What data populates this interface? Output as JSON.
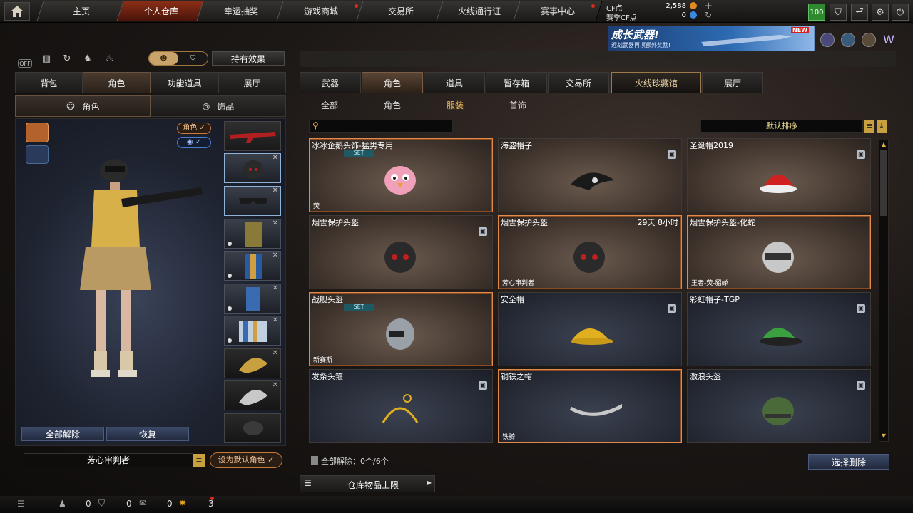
{
  "topnav": {
    "tabs": [
      "主页",
      "个人仓库",
      "幸运抽奖",
      "游戏商城",
      "交易所",
      "火线通行证",
      "赛事中心"
    ],
    "active_index": 1,
    "cf_points_label": "CF点",
    "cf_points_value": "2,588",
    "match_cf_label": "赛季CF点",
    "match_cf_value": "0",
    "level_badge": "100"
  },
  "promo": {
    "title": "成长武器!",
    "subtitle": "近战武器再项额外奖励!",
    "badge": "NEW"
  },
  "left": {
    "off_label": "OFF",
    "hold_effect_label": "持有效果",
    "tabs": [
      "背包",
      "角色",
      "功能道具",
      "展厅"
    ],
    "active_tab": 1,
    "subtabs": [
      "角色",
      "饰品"
    ],
    "badge_role": "角色 ✓",
    "badge_eye": "◉ ✓",
    "unequip_all": "全部解除",
    "restore": "恢复",
    "char_name": "芳心审判者",
    "set_default": "设为默认角色"
  },
  "right": {
    "tabs": [
      "武器",
      "角色",
      "道具",
      "暂存箱",
      "交易所",
      "火线珍藏馆",
      "展厅"
    ],
    "active_tab": 1,
    "subtabs": [
      "全部",
      "角色",
      "服装",
      "首饰"
    ],
    "active_subtab": 2,
    "search_placeholder": "",
    "sort_label": "默认排序",
    "items": [
      {
        "name": "冰冰企鹅头饰-猛男专用",
        "set": "SET",
        "foot": "荧",
        "style": "brown",
        "selected": true
      },
      {
        "name": "海盗帽子",
        "style": "brown",
        "lock": true
      },
      {
        "name": "圣诞帽2019",
        "style": "brown",
        "lock": true
      },
      {
        "name": "烟雲保护头盔",
        "style": "brown",
        "lock": true
      },
      {
        "name": "烟雲保护头盔",
        "time": "29天 8小时",
        "foot": "芳心审判者",
        "style": "brown",
        "selected": true
      },
      {
        "name": "烟雲保护头盔-化蛇",
        "foot": "王者-荧-貂蝉",
        "style": "brown",
        "selected": true
      },
      {
        "name": "战舰头盔",
        "set": "SET",
        "foot": "新赛斯",
        "style": "brown",
        "selected": true
      },
      {
        "name": "安全帽",
        "style": "blue",
        "lock": true
      },
      {
        "name": "彩虹帽子-TGP",
        "style": "blue",
        "lock": true
      },
      {
        "name": "发条头箍",
        "style": "blue",
        "lock": true
      },
      {
        "name": "钢铁之帽",
        "foot": "铁骑",
        "style": "blue",
        "selected": true
      },
      {
        "name": "激浪头盔",
        "style": "blue",
        "lock": true
      }
    ],
    "unequip_summary": "全部解除：0个/6个",
    "select_delete": "选择删除",
    "warehouse_limit": "仓库物品上限"
  },
  "bottombar": {
    "count1": "0",
    "count2": "0",
    "count3": "0",
    "count4": "3"
  }
}
